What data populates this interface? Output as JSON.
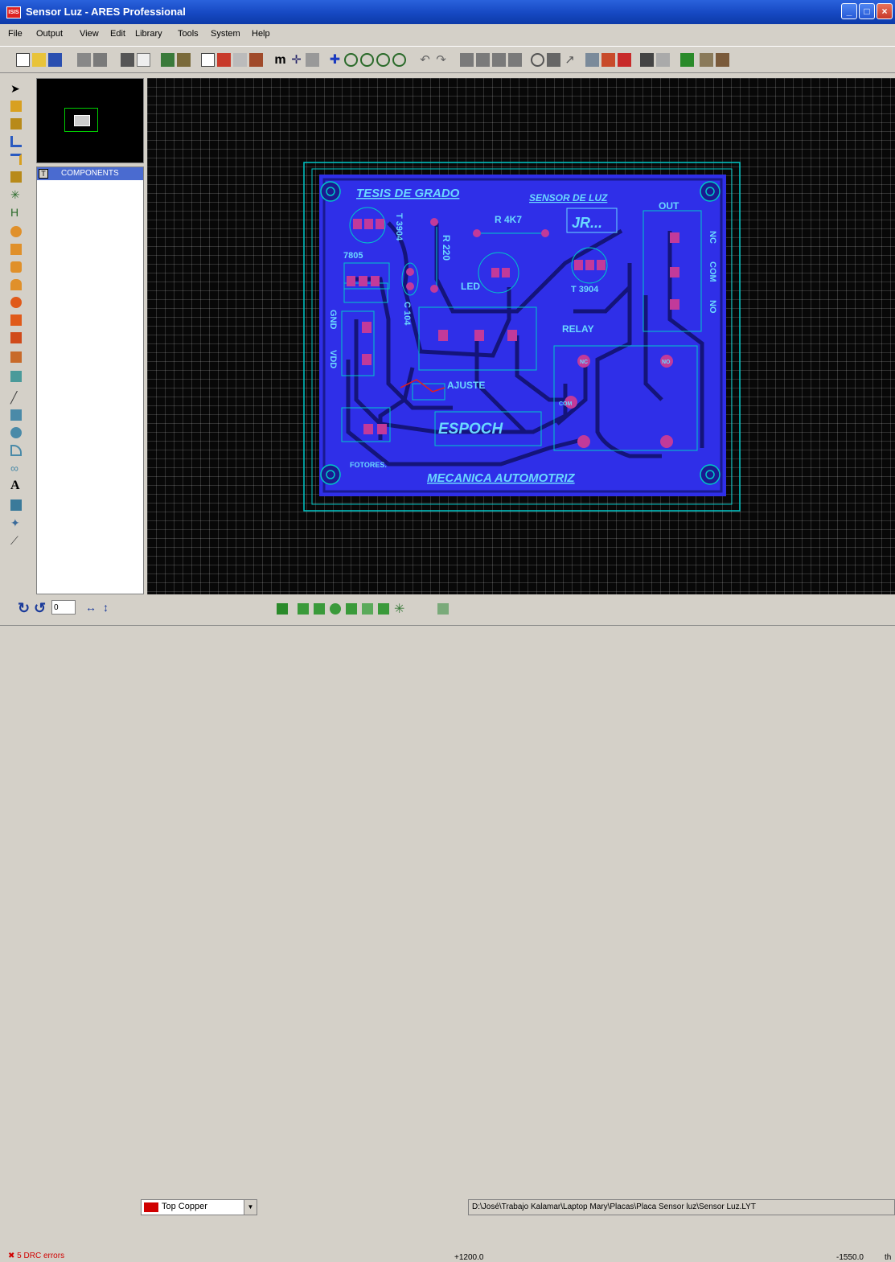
{
  "window": {
    "title": "Sensor Luz - ARES Professional",
    "app_badge": "ISIS"
  },
  "menu": [
    {
      "label": "File"
    },
    {
      "label": "Output"
    },
    {
      "label": "View"
    },
    {
      "label": "Edit"
    },
    {
      "label": "Library"
    },
    {
      "label": "Tools"
    },
    {
      "label": "System"
    },
    {
      "label": "Help"
    }
  ],
  "components_panel": {
    "title": "COMPONENTS",
    "toggle": "T"
  },
  "pcb": {
    "silkscreen": {
      "title": "TESIS DE GRADO",
      "sensor": "SENSOR DE LUZ",
      "initials": "JR...",
      "out": "OUT",
      "r4k7": "R 4K7",
      "r220": "R 220",
      "t1": "T 3904",
      "reg": "7805",
      "led": "LED",
      "t2": "T 3904",
      "nc": "NC",
      "com": "COM",
      "no": "NO",
      "gnd": "GND",
      "c104": "C 104",
      "relay": "RELAY",
      "vdd": "VDD",
      "ajuste": "AJUSTE",
      "espoch": "ESPOCH",
      "relay_com": "COM",
      "relay_nc": "NC",
      "relay_no": "NO",
      "fotores": "FOTORES.",
      "mecanica": "MECANICA AUTOMOTRIZ"
    }
  },
  "bottom": {
    "rotation": "0",
    "layer": "Top Copper",
    "path": "D:\\José\\Trabajo Kalamar\\Laptop Mary\\Placas\\Placa Sensor luz\\Sensor Luz.LYT"
  },
  "status": {
    "drc": "5 DRC errors",
    "x": "+1200.0",
    "y": "-1550.0",
    "unit": "th"
  },
  "colors": {
    "copper": "#2f2fe8",
    "pad": "#c23a9a",
    "silk": "#6ad8ff",
    "outline": "#00c8c8"
  }
}
